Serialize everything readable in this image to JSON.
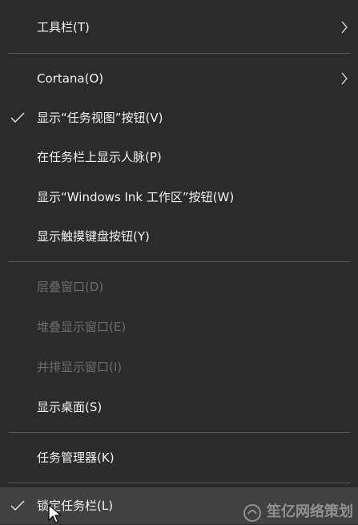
{
  "menu": {
    "items": [
      {
        "label": "工具栏(T)"
      },
      {
        "label": "Cortana(O)"
      },
      {
        "label": "显示“任务视图”按钮(V)"
      },
      {
        "label": "在任务栏上显示人脉(P)"
      },
      {
        "label": "显示“Windows Ink 工作区”按钮(W)"
      },
      {
        "label": "显示触摸键盘按钮(Y)"
      },
      {
        "label": "层叠窗口(D)"
      },
      {
        "label": "堆叠显示窗口(E)"
      },
      {
        "label": "并排显示窗口(I)"
      },
      {
        "label": "显示桌面(S)"
      },
      {
        "label": "任务管理器(K)"
      },
      {
        "label": "锁定任务栏(L)"
      }
    ]
  },
  "icons": {
    "submenu_arrow": "chevron-right-icon",
    "checkmark": "checkmark-icon",
    "cursor": "mouse-pointer-icon"
  },
  "watermark": {
    "text": "笙亿网络策划"
  },
  "colors": {
    "background": "#2b2b2b",
    "text": "#f2f2f2",
    "disabled_text": "#6d6d6d",
    "separator": "#5a5a5a",
    "hover": "#414141"
  }
}
